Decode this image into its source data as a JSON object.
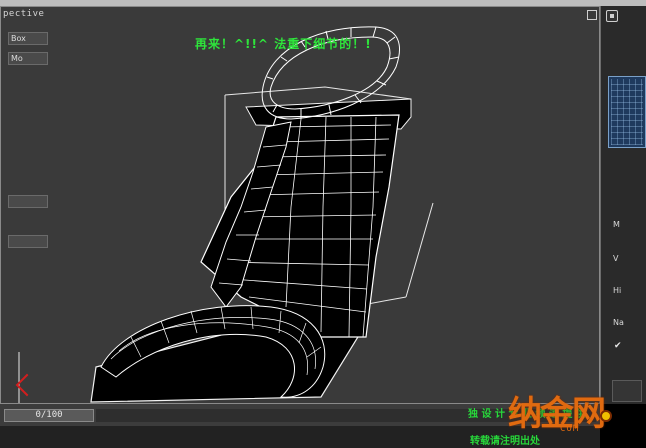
{
  "viewport": {
    "label": "pective",
    "caption": "再来！^!!^ 法重下细节的！!"
  },
  "timeline": {
    "frame_readout": "0/100"
  },
  "command_panel": {
    "button_1": "Box",
    "button_2": "Mo",
    "label_hi": "Hi",
    "label_na": "Na",
    "label_m": "M",
    "label_v": "V"
  },
  "overlay": {
    "line_1": "独  设 计 专 业 频 道 提 供",
    "line_2": "转载请注明出处",
    "logo_text": "纳金网",
    "logo_sub": "COM"
  },
  "colors": {
    "viewport_bg": "#3a3a3a",
    "mesh_fill": "#000000",
    "mesh_wire": "#ffffff",
    "caption": "#2ee43b",
    "logo": "#e06a10"
  }
}
